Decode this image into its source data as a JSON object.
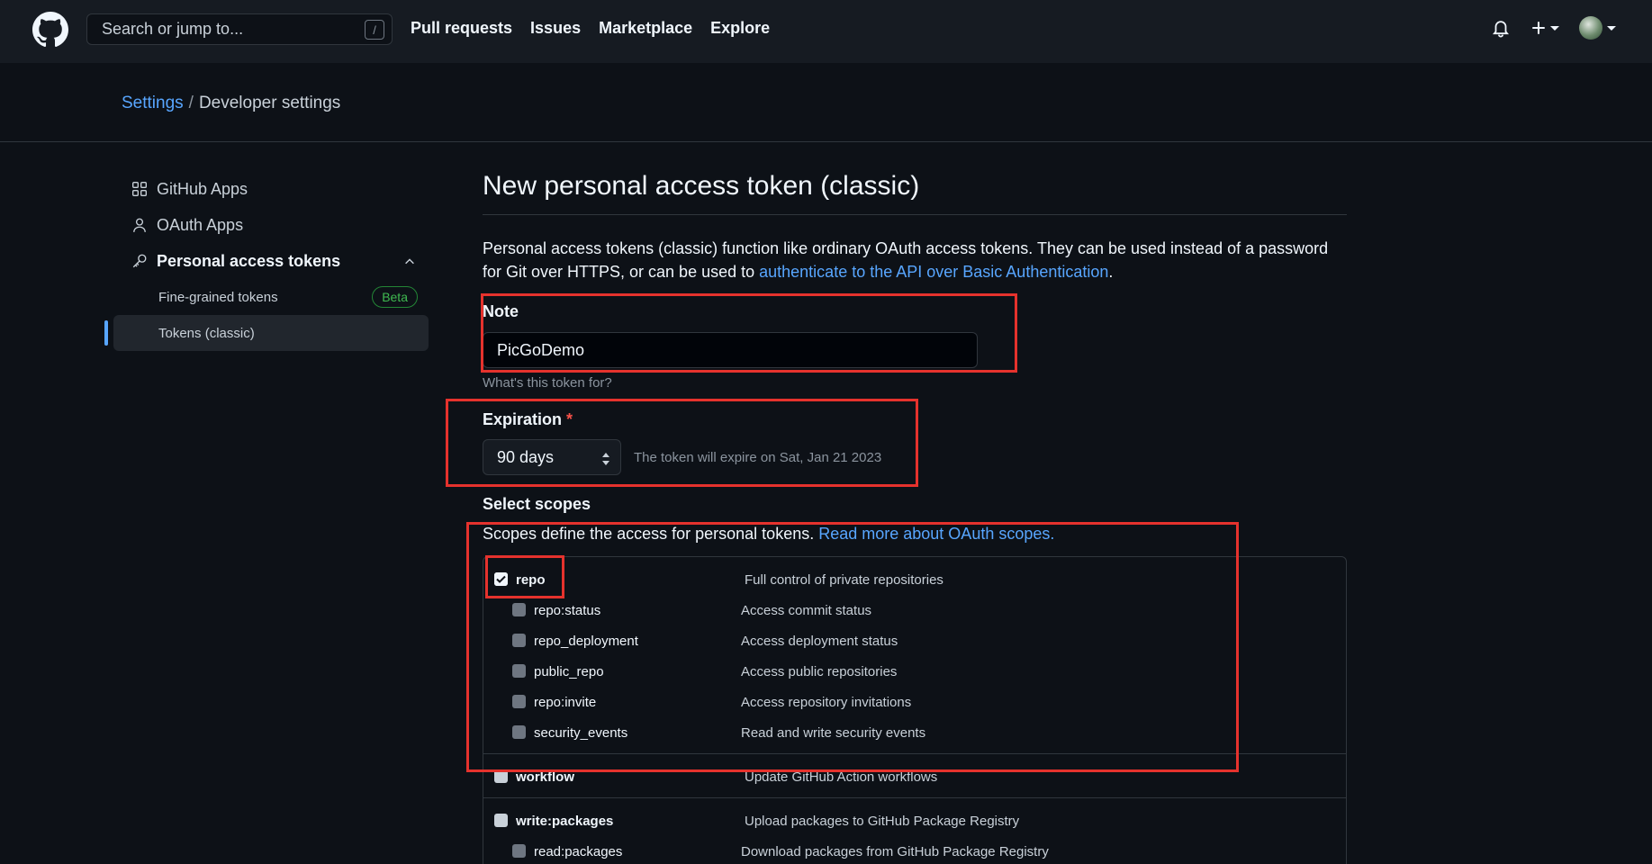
{
  "header": {
    "search_placeholder": "Search or jump to...",
    "search_shortcut": "/",
    "nav": [
      "Pull requests",
      "Issues",
      "Marketplace",
      "Explore"
    ]
  },
  "breadcrumb": {
    "settings": "Settings",
    "separator": "/",
    "current": "Developer settings"
  },
  "sidebar": {
    "items": [
      {
        "label": "GitHub Apps",
        "icon": "apps-grid-icon"
      },
      {
        "label": "OAuth Apps",
        "icon": "person-icon"
      },
      {
        "label": "Personal access tokens",
        "icon": "key-icon"
      }
    ],
    "sub_items": [
      {
        "label": "Fine-grained tokens",
        "badge": "Beta"
      },
      {
        "label": "Tokens (classic)"
      }
    ]
  },
  "main": {
    "title": "New personal access token (classic)",
    "desc_prefix": "Personal access tokens (classic) function like ordinary OAuth access tokens. They can be used instead of a password for Git over HTTPS, or can be used to ",
    "desc_link": "authenticate to the API over Basic Authentication",
    "desc_suffix": ".",
    "note": {
      "label": "Note",
      "value": "PicGoDemo",
      "hint": "What's this token for?"
    },
    "expiration": {
      "label": "Expiration",
      "required": "*",
      "selected": "90 days",
      "note": "The token will expire on Sat, Jan 21 2023"
    },
    "scopes": {
      "label": "Select scopes",
      "desc_prefix": "Scopes define the access for personal tokens. ",
      "desc_link": "Read more about OAuth scopes.",
      "groups": [
        {
          "name": "repo",
          "desc": "Full control of private repositories",
          "checked": true,
          "children": [
            {
              "name": "repo:status",
              "desc": "Access commit status"
            },
            {
              "name": "repo_deployment",
              "desc": "Access deployment status"
            },
            {
              "name": "public_repo",
              "desc": "Access public repositories"
            },
            {
              "name": "repo:invite",
              "desc": "Access repository invitations"
            },
            {
              "name": "security_events",
              "desc": "Read and write security events"
            }
          ]
        },
        {
          "name": "workflow",
          "desc": "Update GitHub Action workflows",
          "checked": false,
          "children": []
        },
        {
          "name": "write:packages",
          "desc": "Upload packages to GitHub Package Registry",
          "checked": false,
          "children": [
            {
              "name": "read:packages",
              "desc": "Download packages from GitHub Package Registry"
            }
          ]
        }
      ]
    }
  },
  "colors": {
    "background": "#0d1117",
    "header": "#161b22",
    "link": "#58a6ff",
    "annotation": "#e5322d",
    "beta": "#3fb950"
  }
}
